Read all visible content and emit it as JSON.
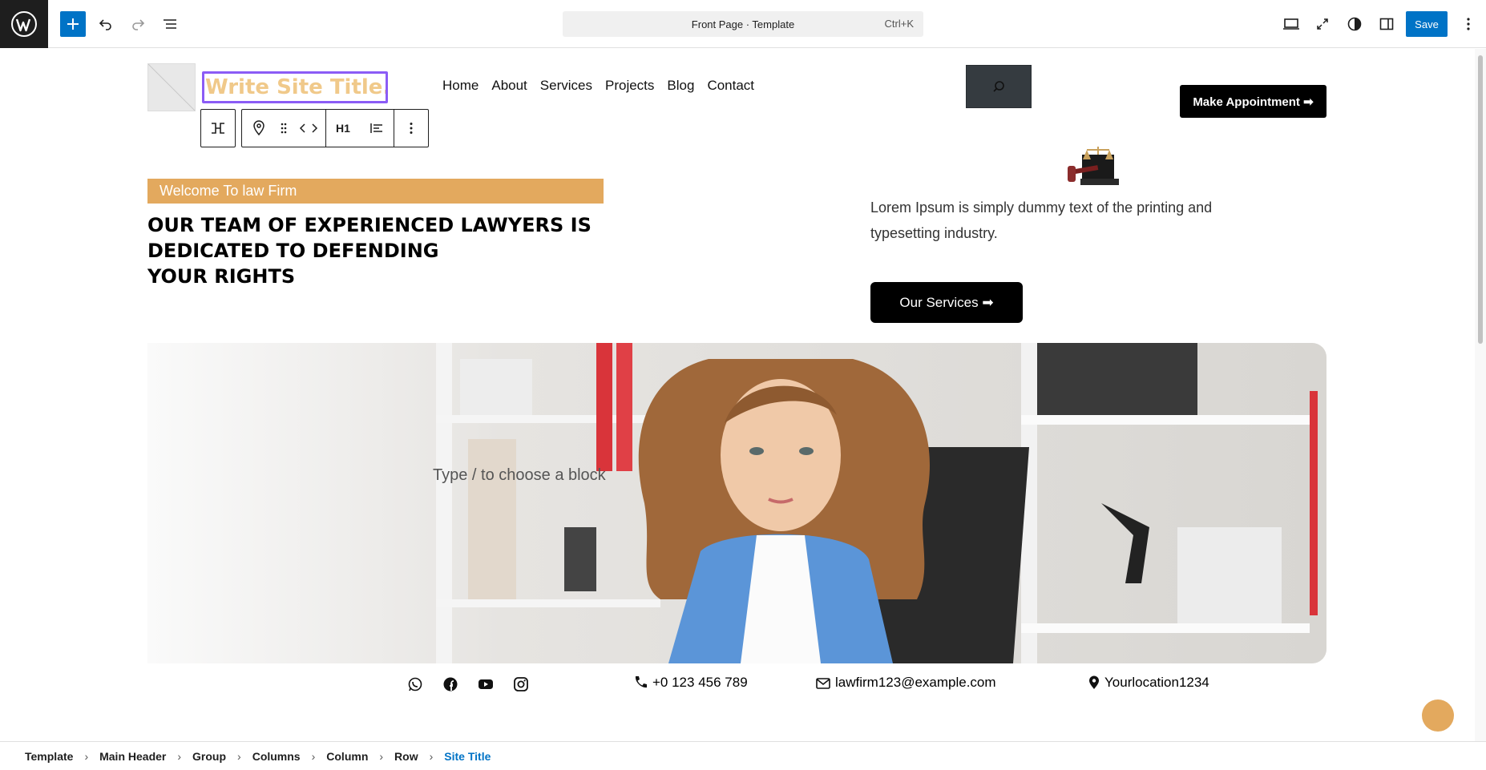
{
  "editor": {
    "document_title": "Front Page · Template",
    "shortcut": "Ctrl+K",
    "save_label": "Save",
    "accent_color": "#0073c6"
  },
  "header": {
    "site_title_placeholder": "Write Site Title...",
    "nav": [
      "Home",
      "About",
      "Services",
      "Projects",
      "Blog",
      "Contact"
    ],
    "appointment_label": "Make Appointment ➡"
  },
  "hero": {
    "welcome": "Welcome To law Firm",
    "heading_lines": [
      "OUR TEAM OF EXPERIENCED LAWYERS IS",
      "DEDICATED TO DEFENDING",
      "YOUR RIGHTS"
    ],
    "description": "Lorem Ipsum is simply dummy text of the printing and typesetting industry.",
    "services_label": "Our Services ➡",
    "block_placeholder": "Type / to choose a block"
  },
  "contact": {
    "phone": "+0 123 456 789",
    "email": "lawfirm123@example.com",
    "location": "Yourlocation1234"
  },
  "block_toolbar": {
    "heading_level": "H1"
  },
  "breadcrumb": [
    "Template",
    "Main Header",
    "Group",
    "Columns",
    "Column",
    "Row",
    "Site Title"
  ]
}
